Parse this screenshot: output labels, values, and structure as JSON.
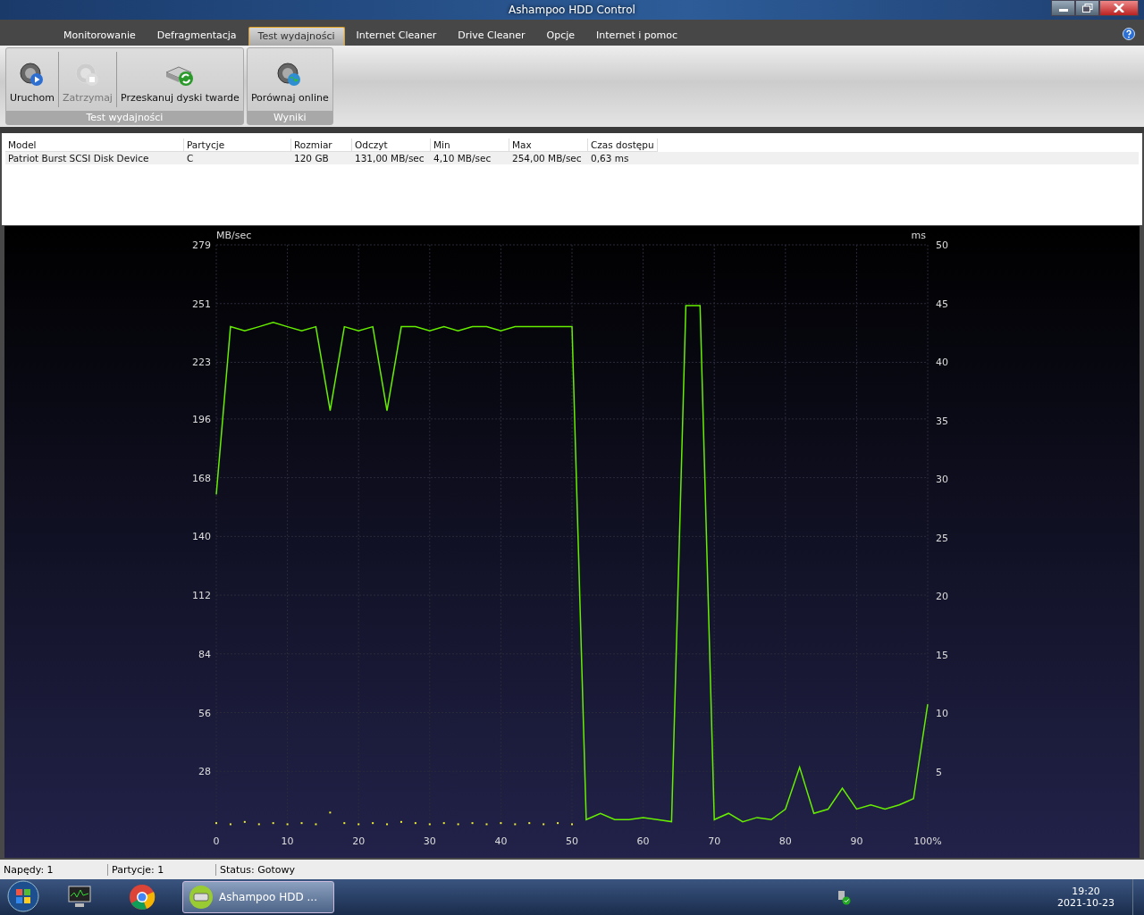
{
  "window": {
    "title": "Ashampoo HDD Control"
  },
  "tabs": [
    {
      "label": "Monitorowanie",
      "selected": false
    },
    {
      "label": "Defragmentacja",
      "selected": false
    },
    {
      "label": "Test wydajności",
      "selected": true
    },
    {
      "label": "Internet Cleaner",
      "selected": false
    },
    {
      "label": "Drive Cleaner",
      "selected": false
    },
    {
      "label": "Opcje",
      "selected": false
    },
    {
      "label": "Internet i pomoc",
      "selected": false
    }
  ],
  "ribbon_groups": [
    {
      "label": "Test wydajności",
      "buttons": [
        {
          "label": "Uruchom",
          "kind": "play",
          "disabled": false
        },
        {
          "label": "Zatrzymaj",
          "kind": "stop",
          "disabled": true
        },
        {
          "label": "Przeskanuj dyski twarde",
          "kind": "rescan",
          "disabled": false
        }
      ]
    },
    {
      "label": "Wyniki",
      "buttons": [
        {
          "label": "Porównaj online",
          "kind": "globe",
          "disabled": false
        }
      ]
    }
  ],
  "table": {
    "columns": [
      "Model",
      "Partycje",
      "Rozmiar",
      "Odczyt",
      "Min",
      "Max",
      "Czas dostępu"
    ],
    "rows": [
      [
        "Patriot Burst SCSI Disk Device",
        "C",
        "120 GB",
        "131,00 MB/sec",
        "4,10 MB/sec",
        "254,00 MB/sec",
        "0,63 ms"
      ]
    ]
  },
  "chart": {
    "chart_data": {
      "type": "line",
      "ylabel": "MB/sec",
      "y2label": "ms",
      "x": [
        0,
        2,
        4,
        6,
        8,
        10,
        12,
        14,
        16,
        18,
        20,
        22,
        24,
        26,
        28,
        30,
        32,
        34,
        36,
        38,
        40,
        42,
        44,
        46,
        48,
        50,
        52,
        54,
        56,
        58,
        60,
        62,
        64,
        66,
        68,
        70,
        72,
        74,
        76,
        78,
        80,
        82,
        84,
        86,
        88,
        90,
        92,
        94,
        96,
        98,
        100
      ],
      "series": [
        {
          "color": "#66ee00",
          "values": [
            160,
            240,
            238,
            240,
            242,
            240,
            238,
            240,
            200,
            240,
            238,
            240,
            200,
            240,
            240,
            238,
            240,
            238,
            240,
            240,
            238,
            240,
            240,
            240,
            240,
            240,
            5,
            8,
            5,
            5,
            6,
            5,
            4,
            250,
            250,
            5,
            8,
            4,
            6,
            5,
            10,
            30,
            8,
            10,
            20,
            10,
            12,
            10,
            12,
            15,
            60
          ]
        },
        {
          "color": "#eeee33",
          "type": "scatter",
          "axis": "y2",
          "values": [
            0.6,
            0.5,
            0.7,
            0.5,
            0.6,
            0.5,
            0.6,
            0.5,
            1.5,
            0.6,
            0.5,
            0.6,
            0.5,
            0.7,
            0.6,
            0.5,
            0.6,
            0.5,
            0.6,
            0.5,
            0.6,
            0.5,
            0.6,
            0.5,
            0.6,
            0.5,
            null,
            null,
            null,
            null,
            null,
            null,
            null,
            null,
            null,
            null,
            null,
            null,
            null,
            null,
            null,
            null,
            null,
            null,
            null,
            null,
            null,
            null,
            null,
            null,
            null
          ]
        }
      ],
      "grid": true,
      "y2lim": [
        0,
        50
      ],
      "xlim": [
        0,
        100
      ],
      "ylim": [
        0,
        279
      ],
      "xticks": [
        0,
        10,
        20,
        30,
        40,
        50,
        60,
        70,
        80,
        90,
        {
          "value": 100,
          "label": "100%"
        }
      ],
      "yticks": [
        28,
        56,
        84,
        112,
        140,
        168,
        196,
        223,
        251,
        279
      ],
      "y2ticks": [
        5,
        10,
        15,
        20,
        25,
        30,
        35,
        40,
        45,
        50
      ]
    }
  },
  "status_bar": [
    "Napędy: 1",
    "Partycje: 1",
    "Status: Gotowy"
  ],
  "taskbar": {
    "active_app": "Ashampoo HDD ...",
    "time": "19:20",
    "date": "2021-10-23"
  }
}
